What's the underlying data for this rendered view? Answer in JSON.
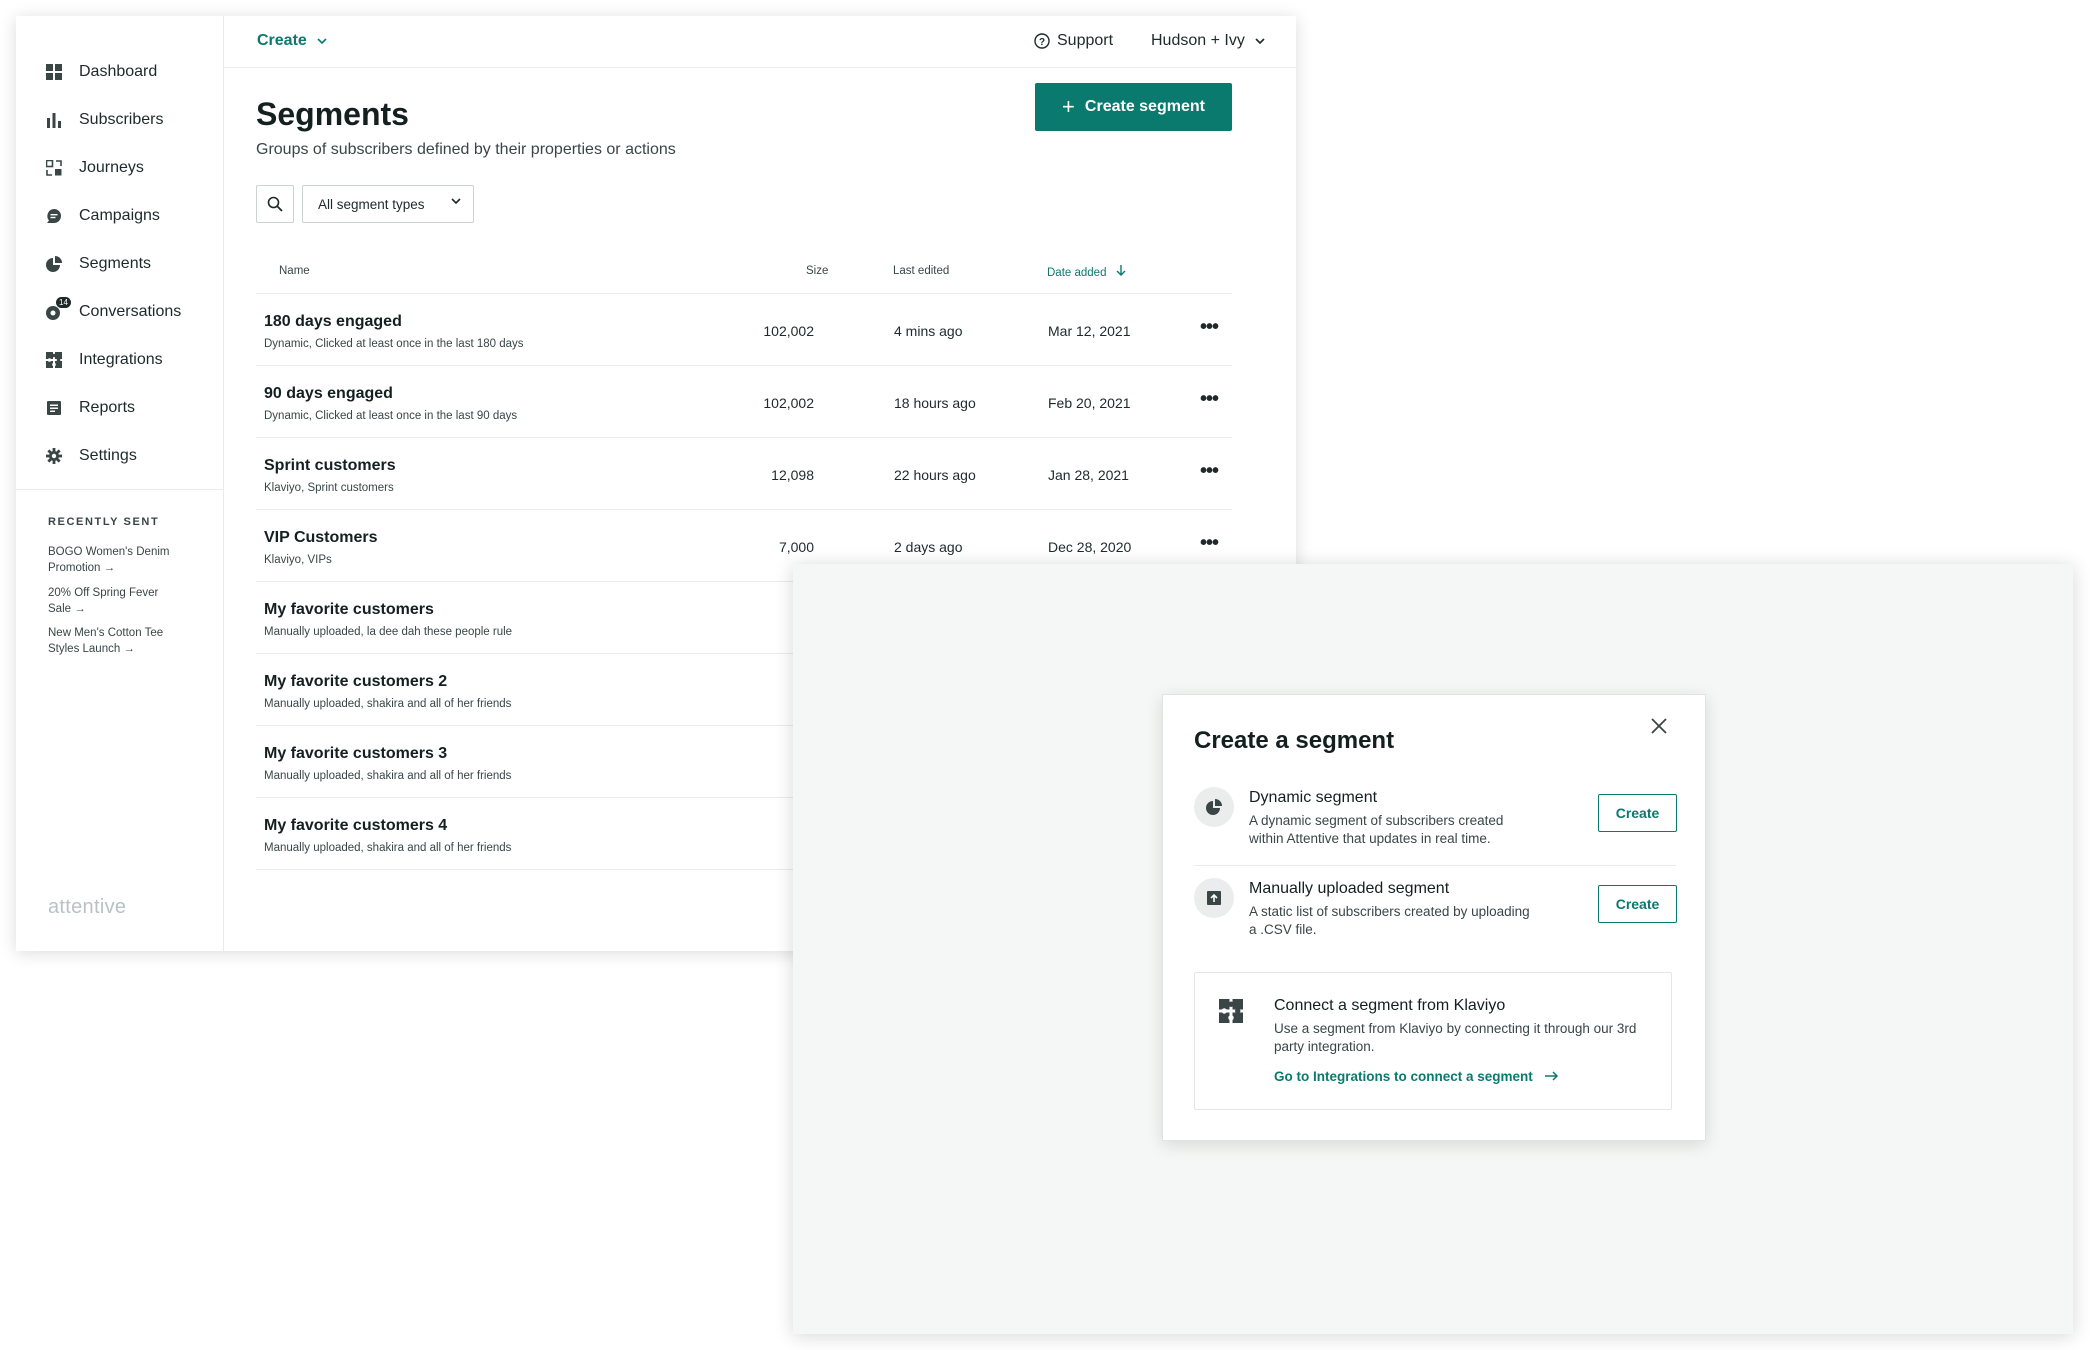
{
  "sidebar": {
    "items": [
      {
        "label": "Dashboard",
        "icon": "dashboard-icon"
      },
      {
        "label": "Subscribers",
        "icon": "bar-chart-icon"
      },
      {
        "label": "Journeys",
        "icon": "journeys-icon"
      },
      {
        "label": "Campaigns",
        "icon": "chat-bubble-icon"
      },
      {
        "label": "Segments",
        "icon": "pie-chart-icon"
      },
      {
        "label": "Conversations",
        "icon": "conversations-icon",
        "badge": "14"
      },
      {
        "label": "Integrations",
        "icon": "puzzle-icon"
      },
      {
        "label": "Reports",
        "icon": "report-icon"
      },
      {
        "label": "Settings",
        "icon": "gear-icon"
      }
    ],
    "recently_sent_title": "RECENTLY SENT",
    "recent": [
      {
        "line1": "BOGO Women's Denim",
        "line2": "Promotion →"
      },
      {
        "line1": "20% Off Spring Fever",
        "line2": "Sale →"
      },
      {
        "line1": "New Men's Cotton Tee",
        "line2": "Styles Launch →"
      }
    ],
    "logo": "attentive"
  },
  "topbar": {
    "create_label": "Create",
    "support_label": "Support",
    "account_label": "Hudson + Ivy"
  },
  "page": {
    "title": "Segments",
    "subtitle": "Groups of subscribers defined by their properties or actions",
    "create_button": "Create segment",
    "filter_label": "All segment types"
  },
  "table": {
    "headers": {
      "name": "Name",
      "size": "Size",
      "last_edited": "Last edited",
      "date_added": "Date added"
    },
    "rows": [
      {
        "name": "180 days engaged",
        "desc": "Dynamic, Clicked at least once in the last 180 days",
        "size": "102,002",
        "last_edited": "4 mins ago",
        "date_added": "Mar 12, 2021"
      },
      {
        "name": "90 days engaged",
        "desc": "Dynamic, Clicked at least once in the last 90 days",
        "size": "102,002",
        "last_edited": "18 hours ago",
        "date_added": "Feb 20, 2021"
      },
      {
        "name": "Sprint customers",
        "desc": "Klaviyo, Sprint customers",
        "size": "12,098",
        "last_edited": "22 hours ago",
        "date_added": "Jan 28, 2021"
      },
      {
        "name": "VIP Customers",
        "desc": "Klaviyo, VIPs",
        "size": "7,000",
        "last_edited": "2 days ago",
        "date_added": "Dec 28, 2020"
      },
      {
        "name": "My favorite customers",
        "desc": "Manually uploaded, la dee dah these people rule"
      },
      {
        "name": "My favorite customers 2",
        "desc": "Manually uploaded, shakira and all of her friends"
      },
      {
        "name": "My favorite customers 3",
        "desc": "Manually uploaded, shakira and all of her friends"
      },
      {
        "name": "My favorite customers 4",
        "desc": "Manually uploaded, shakira and all of her friends"
      }
    ]
  },
  "modal": {
    "title": "Create a segment",
    "options": [
      {
        "name": "Dynamic segment",
        "desc": "A dynamic segment of subscribers created within Attentive that updates in real time.",
        "button": "Create",
        "icon": "pie-chart-icon"
      },
      {
        "name": "Manually uploaded segment",
        "desc": "A static list of subscribers created by uploading a .CSV file.",
        "button": "Create",
        "icon": "upload-icon"
      }
    ],
    "klaviyo": {
      "name": "Connect a segment from Klaviyo",
      "desc": "Use a segment from Klaviyo by connecting it through our 3rd party integration.",
      "link": "Go to Integrations to connect a segment",
      "icon": "puzzle-icon"
    }
  },
  "colors": {
    "accent": "#0b7a6e",
    "text": "#1e2a2a",
    "overlay_bg": "#f5f7f6"
  }
}
